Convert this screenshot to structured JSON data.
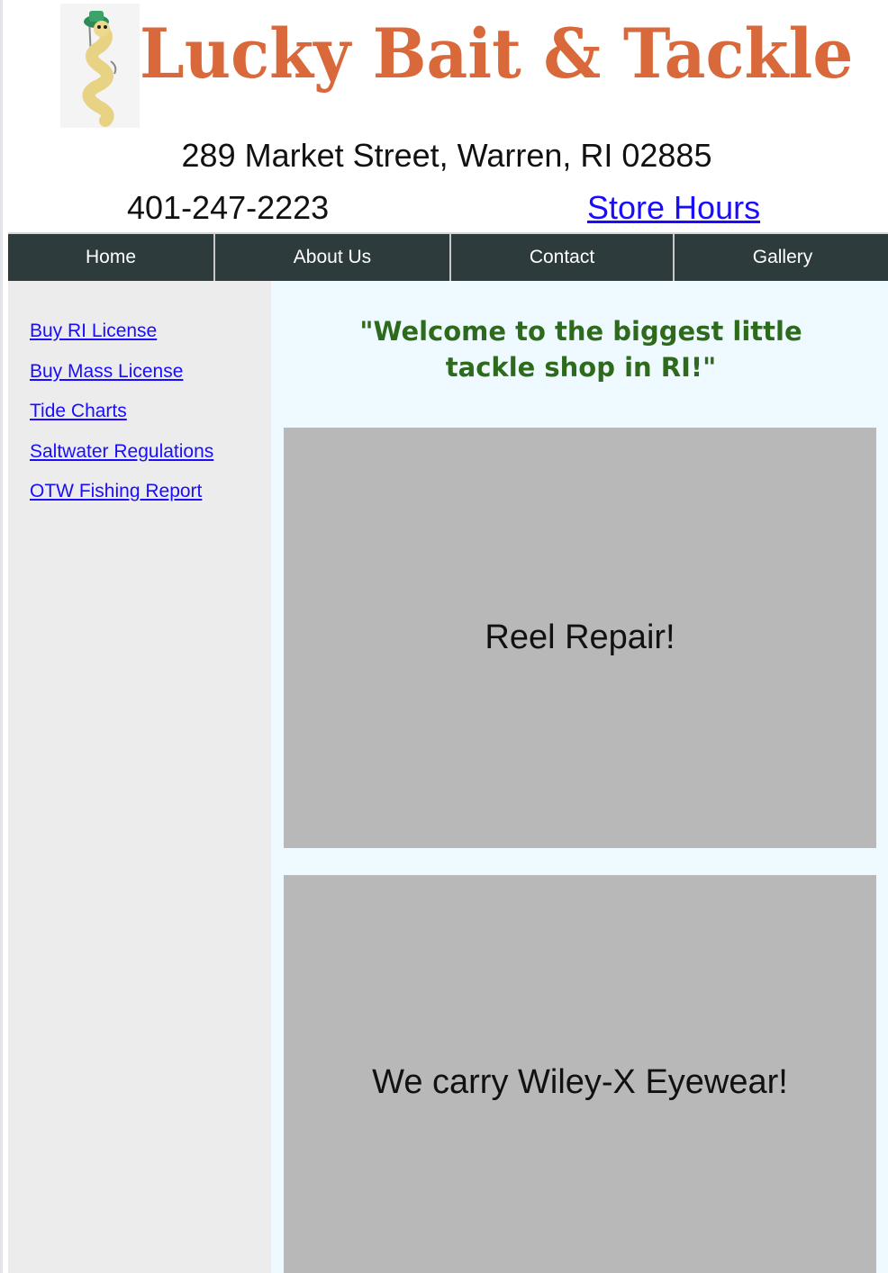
{
  "header": {
    "brand_name": "Lucky Bait & Tackle",
    "logo_icon": "worm-mascot-icon",
    "address": "289 Market Street, Warren, RI 02885",
    "phone": "401-247-2223",
    "store_hours_link": "Store Hours",
    "brand_color": "#d9693b"
  },
  "nav": {
    "items": [
      {
        "label": "Home"
      },
      {
        "label": "About Us"
      },
      {
        "label": "Contact"
      },
      {
        "label": "Gallery"
      }
    ],
    "background_color": "#2e3b3d"
  },
  "sidebar": {
    "links": [
      {
        "label": "Buy RI License"
      },
      {
        "label": "Buy Mass License"
      },
      {
        "label": "Tide Charts"
      },
      {
        "label": "Saltwater Regulations"
      },
      {
        "label": "OTW Fishing Report"
      }
    ],
    "link_color": "#1a0dff"
  },
  "main": {
    "welcome": "\"Welcome to the biggest little tackle shop in RI!\"",
    "welcome_color": "#2d6a1c",
    "promos": [
      {
        "text": "Reel Repair!"
      },
      {
        "text": "We carry Wiley-X Eyewear!"
      }
    ]
  }
}
